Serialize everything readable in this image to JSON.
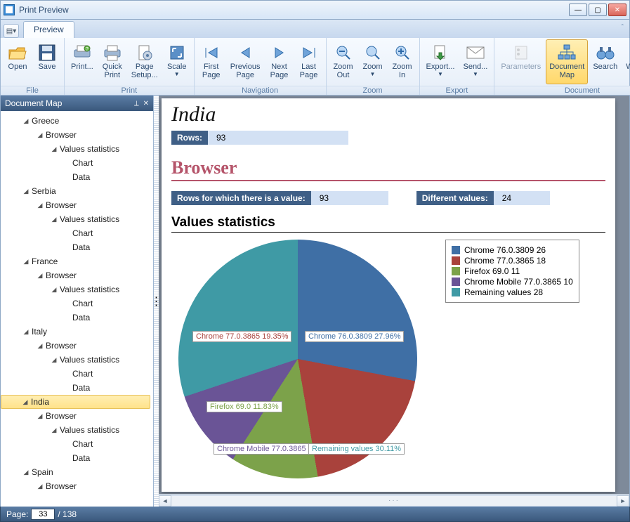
{
  "window": {
    "title": "Print Preview"
  },
  "tabs": {
    "preview": "Preview"
  },
  "ribbon": {
    "groups": {
      "file": "File",
      "print": "Print",
      "navigation": "Navigation",
      "zoom": "Zoom",
      "export": "Export",
      "document": "Document"
    },
    "buttons": {
      "open": "Open",
      "save": "Save",
      "print": "Print...",
      "quick_print": "Quick\nPrint",
      "page_setup": "Page\nSetup...",
      "scale": "Scale",
      "first_page": "First\nPage",
      "previous_page": "Previous\nPage",
      "next_page": "Next\nPage",
      "last_page": "Last\nPage",
      "zoom_out": "Zoom\nOut",
      "zoom": "Zoom",
      "zoom_in": "Zoom\nIn",
      "export": "Export...",
      "send": "Send...",
      "parameters": "Parameters",
      "document_map": "Document\nMap",
      "search": "Search",
      "watermark": "Watermark"
    }
  },
  "docmap": {
    "title": "Document Map",
    "countries": [
      "Greece",
      "Serbia",
      "France",
      "Italy",
      "India",
      "Spain"
    ],
    "node_browser": "Browser",
    "node_values": "Values statistics",
    "leaf_chart": "Chart",
    "leaf_data": "Data",
    "selected": "India"
  },
  "report": {
    "title": "India",
    "rows_label": "Rows:",
    "rows_value": "93",
    "section": "Browser",
    "rows_for_value_label": "Rows for which there is a value:",
    "rows_for_value": "93",
    "different_values_label": "Different values:",
    "different_values": "24",
    "values_stats": "Values statistics"
  },
  "chart_data": {
    "type": "pie",
    "title": "Values statistics",
    "series": [
      {
        "name": "Chrome 76.0.3809",
        "count": 26,
        "pct": 27.96,
        "color": "#3f6fa5"
      },
      {
        "name": "Chrome 77.0.3865",
        "count": 18,
        "pct": 19.35,
        "color": "#a9423c"
      },
      {
        "name": "Firefox 69.0",
        "count": 11,
        "pct": 11.83,
        "color": "#7ca24a"
      },
      {
        "name": "Chrome Mobile 77.0.3865",
        "count": 10,
        "pct": 10.75,
        "color": "#6a5496"
      },
      {
        "name": "Remaining values",
        "count": 28,
        "pct": 30.11,
        "color": "#3f9aa5"
      }
    ],
    "legend_labels": [
      "Chrome 76.0.3809 26",
      "Chrome 77.0.3865 18",
      "Firefox 69.0 11",
      "Chrome Mobile 77.0.3865 10",
      "Remaining values 28"
    ],
    "slice_labels": [
      "Chrome 76.0.3809 27.96%",
      "Chrome 77.0.3865 19.35%",
      "Firefox 69.0 11.83%",
      "Chrome Mobile 77.0.3865 1",
      "Remaining values 30.11%"
    ]
  },
  "status": {
    "page_label": "Page:",
    "current": "33",
    "total": "/ 138"
  }
}
